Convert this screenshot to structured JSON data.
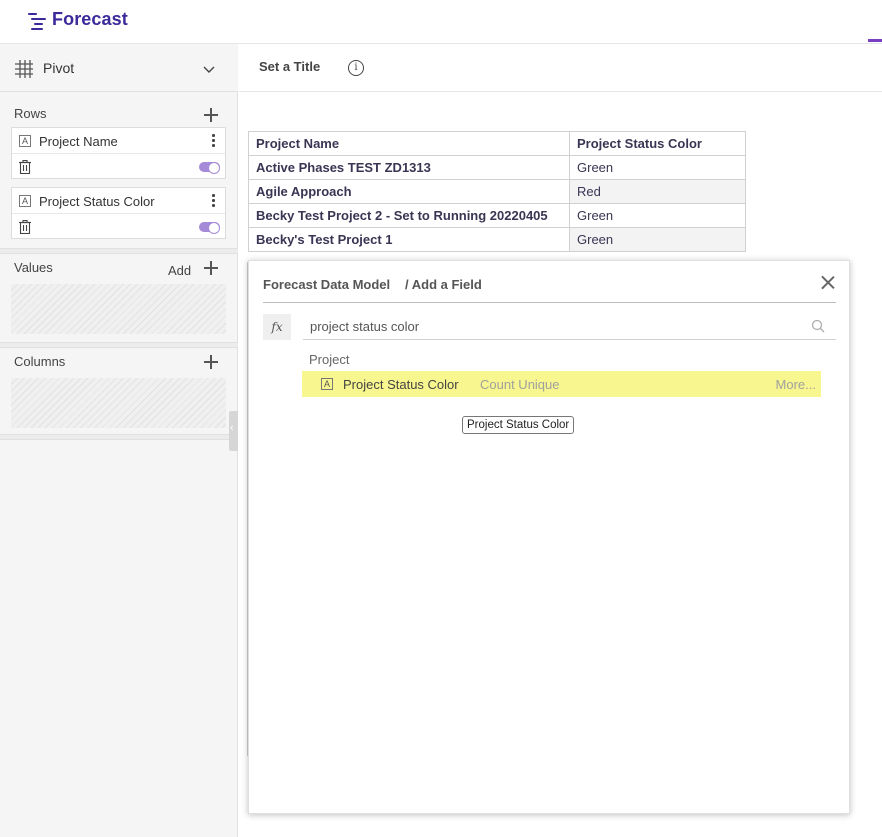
{
  "header": {
    "logo_text": "Forecast",
    "brand_color": "#3b2a9a",
    "accent_color": "#7b3fc4"
  },
  "sidebar": {
    "view_label": "Pivot",
    "rows": {
      "title": "Rows",
      "fields": [
        {
          "type_badge": "A",
          "name": "Project Name",
          "enabled": true
        },
        {
          "type_badge": "A",
          "name": "Project Status Color",
          "enabled": true
        }
      ]
    },
    "values": {
      "title": "Values",
      "add_label": "Add"
    },
    "columns": {
      "title": "Columns"
    }
  },
  "main": {
    "title_placeholder": "Set a Title",
    "info_icon": "i",
    "table": {
      "headers": [
        "Project Name",
        "Project Status Color"
      ],
      "rows": [
        [
          "Active Phases TEST ZD1313",
          "Green"
        ],
        [
          "Agile Approach",
          "Red"
        ],
        [
          "Becky Test Project 2 - Set to Running 20220405",
          "Green"
        ],
        [
          "Becky's Test Project 1",
          "Green"
        ]
      ]
    }
  },
  "dialog": {
    "breadcrumb_root": "Forecast Data Model",
    "breadcrumb_current": "/ Add a Field",
    "fx_label": "fx",
    "search_value": "project status color",
    "group_label": "Project",
    "result": {
      "type_badge": "A",
      "name": "Project Status Color",
      "aggregation": "Count Unique",
      "more_label": "More...",
      "highlight_color": "#f8f68e"
    },
    "tooltip": "Project Status Color"
  }
}
